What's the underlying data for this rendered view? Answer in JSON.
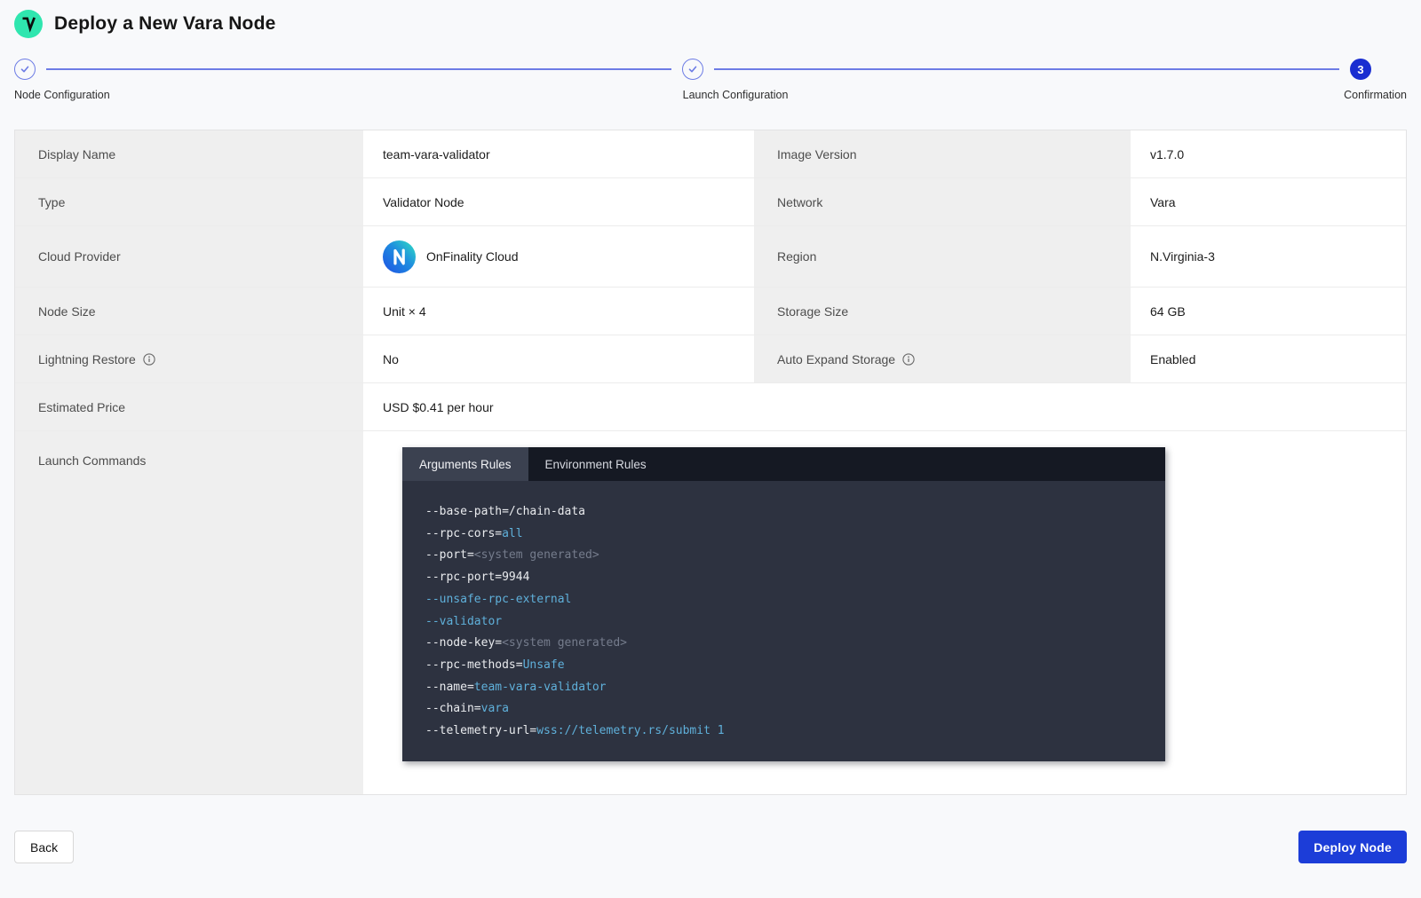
{
  "theme": {
    "accent-blue": "#1c3dd8",
    "stepper-indigo": "#6d7ce5",
    "step-current": "#1a2ed1",
    "logo-green": "#2fe6af",
    "code-bg": "#2d3240",
    "tab-bar-bg": "#151923",
    "tab-active-bg": "#3b4150",
    "code-default": "#e9ebee",
    "code-accent": "#5fb0da",
    "code-muted": "#757c8c"
  },
  "header": {
    "title": "Deploy a New Vara Node",
    "logo": "vara-logo"
  },
  "stepper": {
    "steps": [
      {
        "label": "Node Configuration",
        "state": "complete"
      },
      {
        "label": "Launch Configuration",
        "state": "complete"
      },
      {
        "label": "Confirmation",
        "state": "current",
        "number": "3"
      }
    ]
  },
  "summary": {
    "rows": [
      {
        "cells": [
          {
            "label": "Display Name",
            "value": "team-vara-validator"
          },
          {
            "label": "Image Version",
            "value": "v1.7.0"
          }
        ]
      },
      {
        "cells": [
          {
            "label": "Type",
            "value": "Validator Node"
          },
          {
            "label": "Network",
            "value": "Vara"
          }
        ]
      },
      {
        "tall": true,
        "cells": [
          {
            "label": "Cloud Provider",
            "value": "OnFinality Cloud",
            "value_icon": "onfinality-logo"
          },
          {
            "label": "Region",
            "value": "N.Virginia-3"
          }
        ]
      },
      {
        "cells": [
          {
            "label": "Node Size",
            "value": "Unit × 4"
          },
          {
            "label": "Storage Size",
            "value": "64 GB"
          }
        ]
      },
      {
        "cells": [
          {
            "label": "Lightning Restore",
            "info": true,
            "value": "No"
          },
          {
            "label": "Auto Expand Storage",
            "info": true,
            "value": "Enabled"
          }
        ]
      },
      {
        "cells": [
          {
            "label": "Estimated Price",
            "value": "USD $0.41 per hour",
            "span": true
          }
        ]
      }
    ],
    "launch_commands_label": "Launch Commands"
  },
  "code_panel": {
    "tabs": [
      {
        "label": "Arguments Rules",
        "active": true
      },
      {
        "label": "Environment Rules",
        "active": false
      }
    ],
    "lines": [
      [
        {
          "t": "--base-path=/chain-data",
          "c": "d"
        }
      ],
      [
        {
          "t": "--rpc-cors=",
          "c": "d"
        },
        {
          "t": "all",
          "c": "a"
        }
      ],
      [
        {
          "t": "--port=",
          "c": "d"
        },
        {
          "t": "<system generated>",
          "c": "m"
        }
      ],
      [
        {
          "t": "--rpc-port=9944",
          "c": "d"
        }
      ],
      [
        {
          "t": "--unsafe-rpc-external",
          "c": "a"
        }
      ],
      [
        {
          "t": "--validator",
          "c": "a"
        }
      ],
      [
        {
          "t": "--node-key=",
          "c": "d"
        },
        {
          "t": "<system generated>",
          "c": "m"
        }
      ],
      [
        {
          "t": "--rpc-methods=",
          "c": "d"
        },
        {
          "t": "Unsafe",
          "c": "a"
        }
      ],
      [
        {
          "t": "--name=",
          "c": "d"
        },
        {
          "t": "team-vara-validator",
          "c": "a"
        }
      ],
      [
        {
          "t": "--chain=",
          "c": "d"
        },
        {
          "t": "vara",
          "c": "a"
        }
      ],
      [
        {
          "t": "--telemetry-url=",
          "c": "d"
        },
        {
          "t": "wss://telemetry.rs/submit 1",
          "c": "a"
        }
      ]
    ]
  },
  "footer": {
    "back_label": "Back",
    "deploy_label": "Deploy Node"
  }
}
